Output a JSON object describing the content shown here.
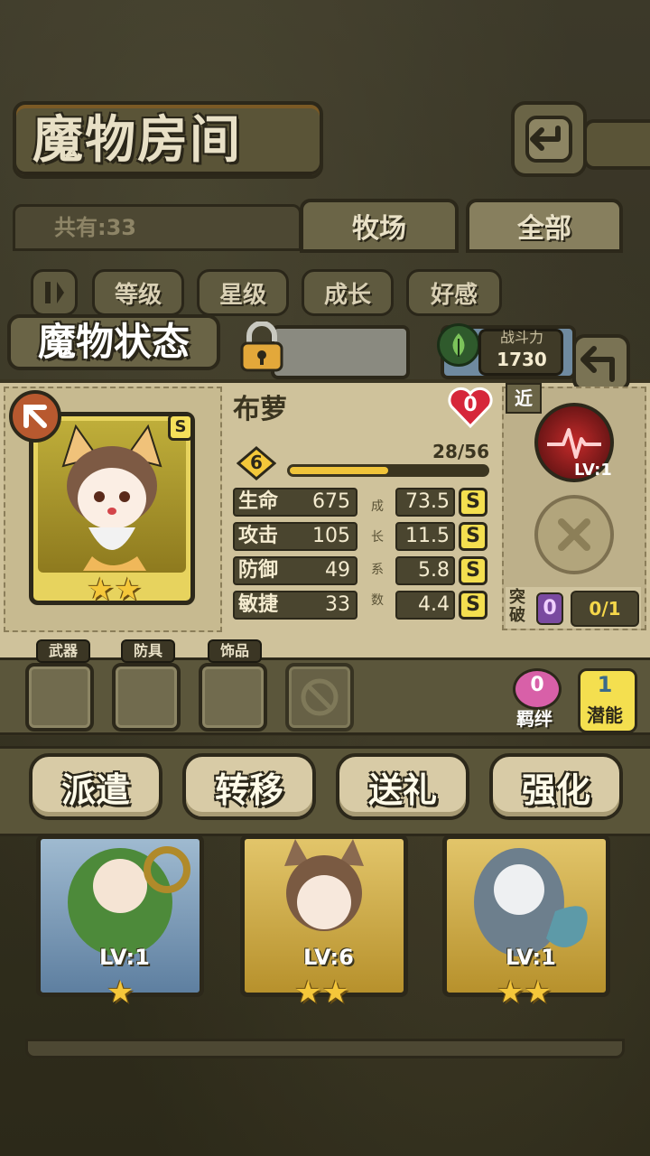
{
  "header": {
    "title": "魔物房间",
    "count_label": "共有:33",
    "tabs": [
      {
        "label": "牧场",
        "active": false
      },
      {
        "label": "全部",
        "active": true
      }
    ]
  },
  "sort": {
    "buttons": [
      "等级",
      "星级",
      "成长",
      "好感"
    ]
  },
  "status": {
    "title": "魔物状态",
    "power_label": "战斗力",
    "power_value": "1730",
    "monster": {
      "name": "布萝",
      "rank": "S",
      "affection": "0",
      "level": "6",
      "exp_text": "28/56",
      "exp_fraction": 0.5,
      "stars": 2
    },
    "stats": [
      {
        "label": "生命",
        "value": "675",
        "growth": "73.5",
        "grade": "S"
      },
      {
        "label": "攻击",
        "value": "105",
        "growth": "11.5",
        "grade": "S"
      },
      {
        "label": "防御",
        "value": "49",
        "growth": "5.8",
        "grade": "S"
      },
      {
        "label": "敏捷",
        "value": "33",
        "growth": "4.4",
        "grade": "S"
      }
    ],
    "growth_vertical": [
      "成",
      "长",
      "系",
      "数"
    ],
    "attack_type": "近",
    "skill_level": "LV:1",
    "breakthrough_label": "突破",
    "breakthrough_count": "0",
    "breakthrough_fraction": "0/1"
  },
  "equipment": {
    "slots": [
      "武器",
      "防具",
      "饰品"
    ],
    "bond_count": "0",
    "bond_label": "羁绊",
    "potential_count": "1",
    "potential_label": "潜能"
  },
  "actions": [
    "派遣",
    "转移",
    "送礼",
    "强化"
  ],
  "cards": [
    {
      "level": "LV:1",
      "stars": 1,
      "color": "blue"
    },
    {
      "level": "LV:6",
      "stars": 2,
      "color": "gold"
    },
    {
      "level": "LV:1",
      "stars": 2,
      "color": "gold"
    }
  ],
  "colors": {
    "panel": "#cfc29b",
    "accent_gold": "#f4df4f",
    "heart_red": "#d6263a"
  }
}
